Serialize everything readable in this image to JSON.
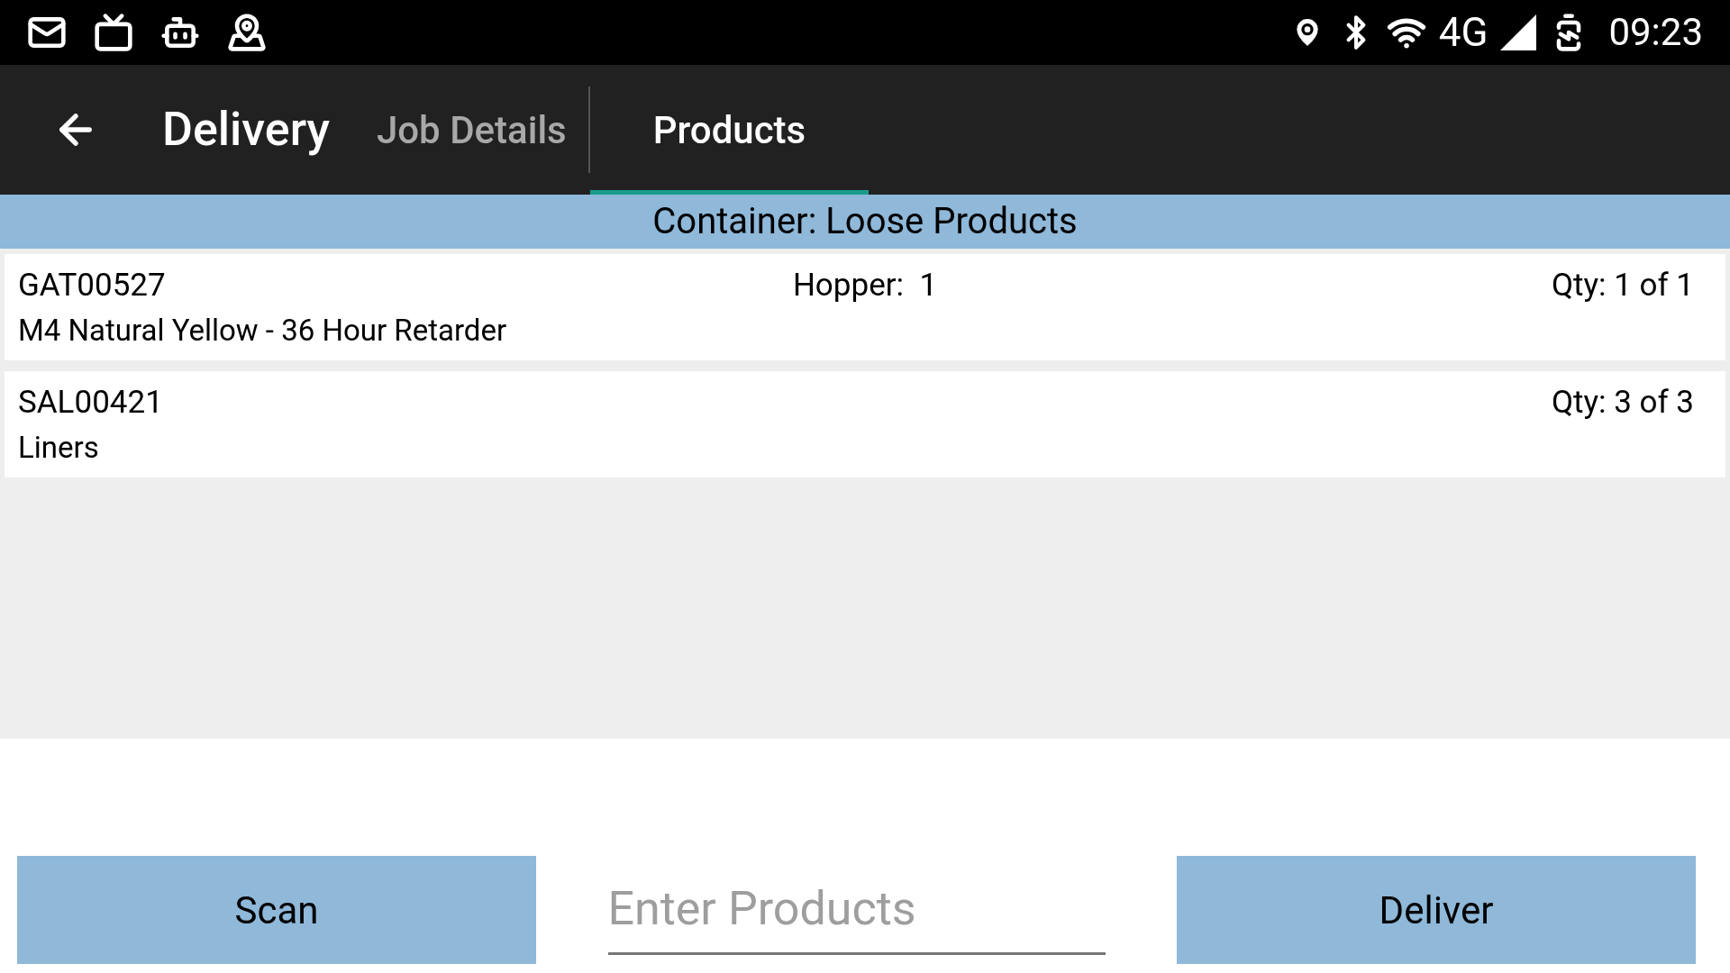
{
  "status_bar": {
    "network": "4G",
    "time": "09:23"
  },
  "app_bar": {
    "title": "Delivery",
    "tabs": [
      {
        "label": "Job Details",
        "selected": false
      },
      {
        "label": "Products",
        "selected": true
      }
    ]
  },
  "container_header": "Container: Loose Products",
  "products": [
    {
      "code": "GAT00527",
      "hopper": "Hopper:  1",
      "qty": "Qty: 1 of 1",
      "description": "M4 Natural Yellow - 36 Hour Retarder"
    },
    {
      "code": "SAL00421",
      "qty": "Qty: 3 of 3",
      "description": "Liners"
    }
  ],
  "scan_button": "Scan",
  "entry_field": {
    "placeholder": "Enter Products"
  },
  "deliver_button": "Deliver"
}
